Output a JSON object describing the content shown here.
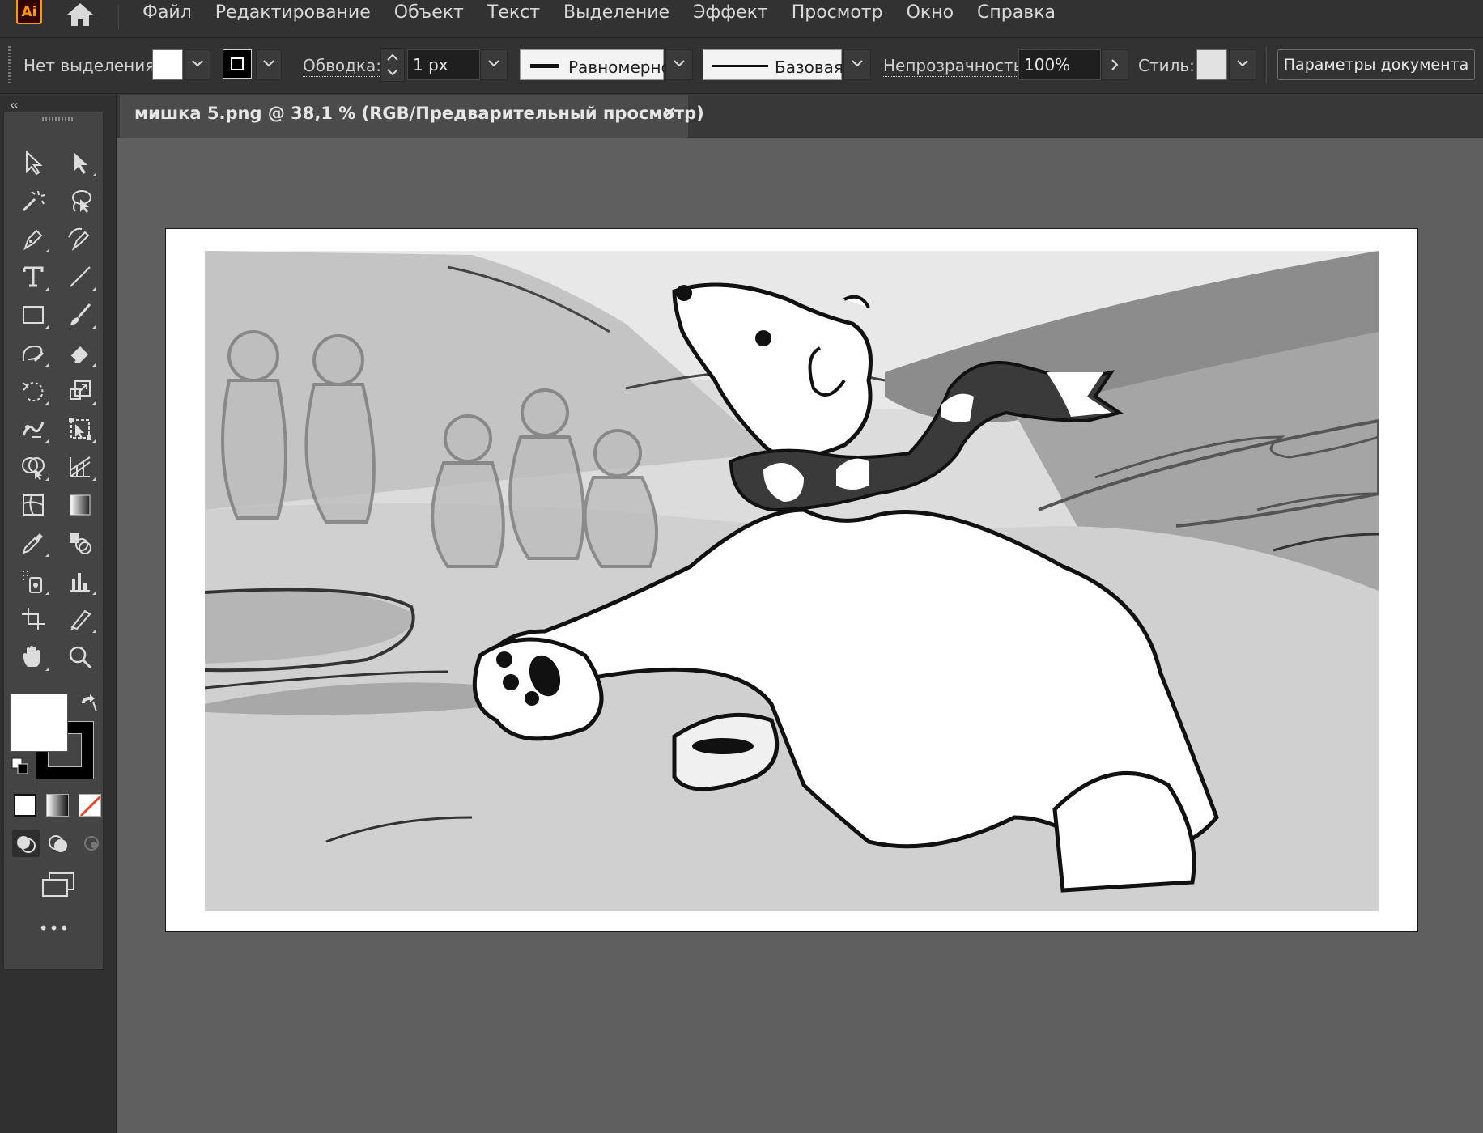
{
  "app": {
    "logo_text": "Ai"
  },
  "menu": [
    "Файл",
    "Редактирование",
    "Объект",
    "Текст",
    "Выделение",
    "Эффект",
    "Просмотр",
    "Окно",
    "Справка"
  ],
  "control_bar": {
    "selection_status": "Нет выделения",
    "stroke_label": "Обводка:",
    "stroke_weight": "1 px",
    "stroke_profile": "Равномерно",
    "brush": "Базовая",
    "opacity_label": "Непрозрачность:",
    "opacity_value": "100%",
    "style_label": "Стиль:",
    "doc_settings_button": "Параметры документа"
  },
  "document_tab": {
    "title": "мишка 5.png @ 38,1 % (RGB/Предварительный просмотр)",
    "close_glyph": "✕"
  },
  "toolbar": {
    "collapse_glyph": "‹‹",
    "more_glyph": "•••",
    "tools": [
      "selection-tool-icon",
      "direct-selection-tool-icon",
      "magic-wand-tool-icon",
      "lasso-tool-icon",
      "pen-tool-icon",
      "curvature-tool-icon",
      "type-tool-icon",
      "line-segment-tool-icon",
      "rectangle-tool-icon",
      "paintbrush-tool-icon",
      "shaper-tool-icon",
      "eraser-tool-icon",
      "rotate-tool-icon",
      "scale-tool-icon",
      "puppet-warp-tool-icon",
      "free-transform-tool-icon",
      "shape-builder-tool-icon",
      "perspective-grid-tool-icon",
      "mesh-tool-icon",
      "gradient-tool-icon",
      "eyedropper-tool-icon",
      "blend-tool-icon",
      "symbol-sprayer-tool-icon",
      "column-graph-tool-icon",
      "artboard-tool-icon",
      "slice-tool-icon",
      "hand-tool-icon",
      "zoom-tool-icon"
    ]
  },
  "colors": {
    "fill": "#ffffff",
    "stroke": "#000000",
    "accent_logo": "#ff9a00",
    "none_swatch_slash": "#e8452c"
  }
}
